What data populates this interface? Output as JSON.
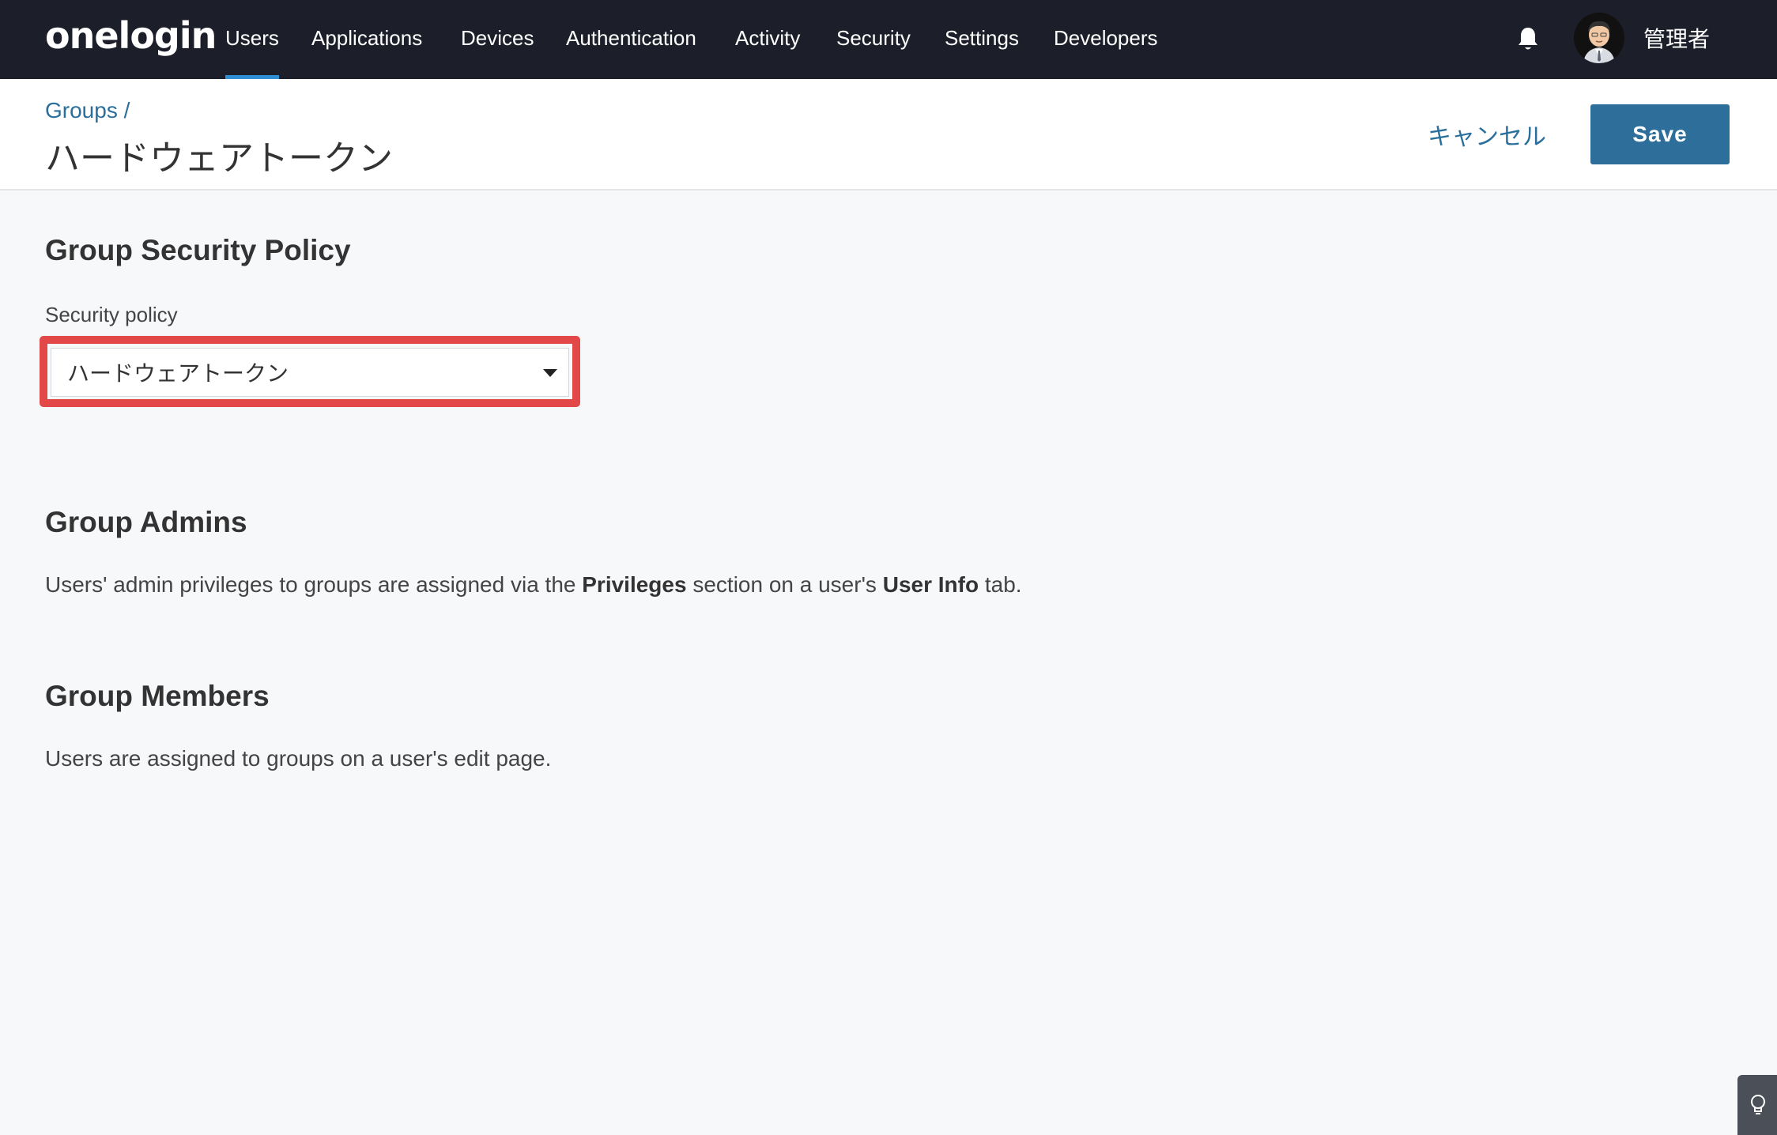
{
  "nav": {
    "logo": "onelogin",
    "items": [
      {
        "label": "Users",
        "active": true
      },
      {
        "label": "Applications"
      },
      {
        "label": "Devices"
      },
      {
        "label": "Authentication"
      },
      {
        "label": "Activity"
      },
      {
        "label": "Security"
      },
      {
        "label": "Settings"
      },
      {
        "label": "Developers"
      }
    ],
    "notification_icon": "bell-icon",
    "user_name": "管理者"
  },
  "header": {
    "breadcrumb": "Groups /",
    "title": "ハードウェアトークン",
    "cancel_label": "キャンセル",
    "save_label": "Save"
  },
  "security_section": {
    "heading": "Group Security Policy",
    "field_label": "Security policy",
    "selected_value": "ハードウェアトークン"
  },
  "admins_section": {
    "heading": "Group Admins",
    "text_1": "Users' admin privileges to groups are assigned via the ",
    "bold_1": "Privileges",
    "text_2": " section on a user's ",
    "bold_2": "User Info",
    "text_3": " tab."
  },
  "members_section": {
    "heading": "Group Members",
    "text": "Users are assigned to groups on a user's edit page."
  },
  "colors": {
    "nav_bg": "#1c1f2a",
    "accent": "#2d6e9a",
    "link": "#2a6f9b",
    "highlight": "#e24848"
  }
}
